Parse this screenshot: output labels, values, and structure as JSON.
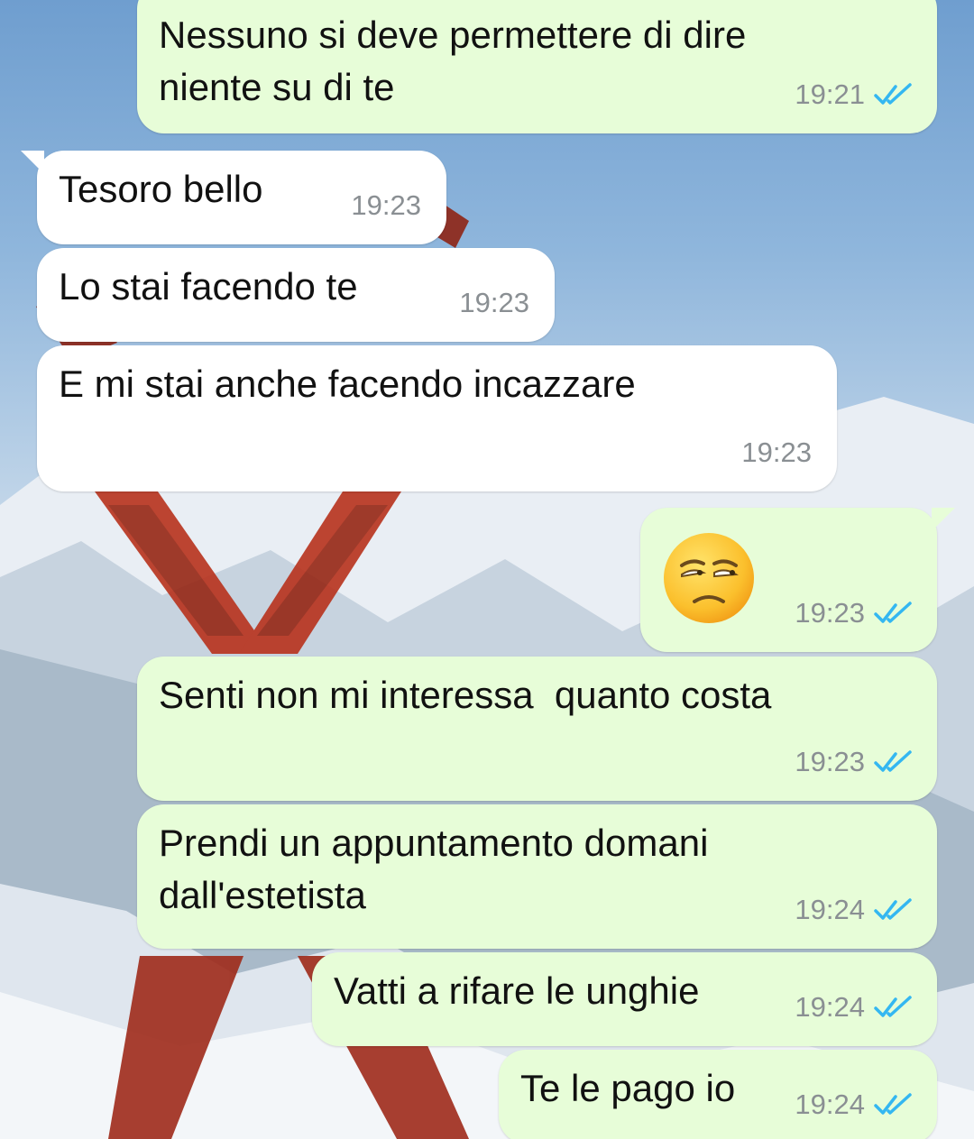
{
  "chat": {
    "messages": [
      {
        "direction": "outgoing",
        "text": "Nessuno si deve permettere di dire\nniente su di te",
        "time": "19:21",
        "read": true
      },
      {
        "direction": "incoming",
        "text": "Tesoro bello",
        "time": "19:23"
      },
      {
        "direction": "incoming",
        "text": "Lo stai facendo te",
        "time": "19:23"
      },
      {
        "direction": "incoming",
        "text": "E mi stai anche facendo incazzare",
        "time": "19:23"
      },
      {
        "direction": "outgoing",
        "text": "",
        "emoji": "unamused-face-emoji",
        "time": "19:23",
        "read": true
      },
      {
        "direction": "outgoing",
        "text": "Senti non mi interessa  quanto costa",
        "time": "19:23",
        "read": true
      },
      {
        "direction": "outgoing",
        "text": "Prendi un appuntamento domani\ndall'estetista",
        "time": "19:24",
        "read": true
      },
      {
        "direction": "outgoing",
        "text": "Vatti a rifare le unghie",
        "time": "19:24",
        "read": true
      },
      {
        "direction": "outgoing",
        "text": "Te le pago io",
        "time": "19:24",
        "read": true
      }
    ]
  },
  "colors": {
    "outgoing_bubble": "#e7fdd8",
    "incoming_bubble": "#ffffff",
    "read_ticks": "#34b7f1",
    "timestamp": "#8a8f93"
  },
  "wallpaper": {
    "subject": "snowy-mountains-with-crossed-red-skis"
  }
}
